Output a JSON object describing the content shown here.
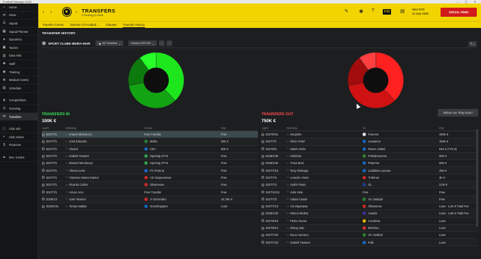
{
  "window": {
    "title": "Football Manager 2023",
    "controls": "– ▢ ✕"
  },
  "sidebar": {
    "items": [
      {
        "label": "Home",
        "icon": "home-icon",
        "glyph": "⌂"
      },
      {
        "label": "Inbox",
        "icon": "inbox-icon",
        "glyph": "✉"
      },
      {
        "label": "Squad",
        "icon": "squad-icon",
        "glyph": "☰"
      },
      {
        "label": "Squad Planner",
        "icon": "planner-icon",
        "glyph": "▦"
      },
      {
        "label": "Dynamics",
        "icon": "dynamics-icon",
        "glyph": "♥"
      },
      {
        "label": "Tactics",
        "icon": "tactics-icon",
        "glyph": "▣"
      },
      {
        "label": "Data Hub",
        "icon": "data-hub-icon",
        "glyph": "▥"
      },
      {
        "label": "Staff",
        "icon": "staff-icon",
        "glyph": "☻"
      },
      {
        "label": "Training",
        "icon": "training-icon",
        "glyph": "◉"
      },
      {
        "label": "Medical Centre",
        "icon": "medical-icon",
        "glyph": "✚"
      },
      {
        "label": "Schedule",
        "icon": "schedule-icon",
        "glyph": "▤"
      },
      {
        "label": "Competitions",
        "icon": "trophy-icon",
        "glyph": "♛"
      },
      {
        "label": "Scouting",
        "icon": "scouting-icon",
        "glyph": "◎"
      },
      {
        "label": "Transfers",
        "icon": "transfers-icon",
        "glyph": "⇄"
      },
      {
        "label": "Club Info",
        "icon": "club-info-icon",
        "glyph": "ⓘ"
      },
      {
        "label": "Club Vision",
        "icon": "club-vision-icon",
        "glyph": "◐"
      },
      {
        "label": "Finances",
        "icon": "finances-icon",
        "glyph": "$"
      },
      {
        "label": "Dev. Centre",
        "icon": "dev-centre-icon",
        "glyph": "▲"
      }
    ],
    "active_index": 13
  },
  "header": {
    "title": "TRANSFERS",
    "subtitle": "0 Pending (0) HAHI",
    "date_line1": "Wed 9:00",
    "date_line2": "13 Sep 2028",
    "social_feed": "SOCIAL FEED",
    "accent": "#f2d500"
  },
  "subnav": {
    "tabs": [
      "Transfer Centre",
      "Director of Football ⌄",
      "Clauses",
      "Transfer History"
    ],
    "active_index": 3
  },
  "page": {
    "section_title": "TRANSFER HISTORY",
    "club_name": "SPORT CLUBE BEIRA-MAR",
    "filter_label": "All Transfers",
    "season_label": "Season 2027/28",
    "where_button": "Where Are They Now?"
  },
  "transfers_in": {
    "title": "TRANSFERS IN",
    "total": "100K €",
    "color": "#35e05a",
    "headers": [
      "DATE",
      "PERSON",
      "FROM",
      "FEE"
    ],
    "rows": [
      {
        "date": "2027/7/1",
        "person": "Imanol Michelucci",
        "club": "Free Transfer",
        "fee": "Free",
        "badge": ""
      },
      {
        "date": "2027/7/1",
        "person": "José Eduardo",
        "club": "Mafra",
        "fee": "25K €",
        "badge": "#2e7d32"
      },
      {
        "date": "2027/7/1",
        "person": "Clodoil",
        "club": "CEA",
        "fee": "60K €",
        "badge": "#1565c0"
      },
      {
        "date": "2027/7/1",
        "person": "Gabriel Tavares",
        "club": "Sporting CP B",
        "fee": "Free",
        "badge": "#2e9e4f"
      },
      {
        "date": "2027/7/1",
        "person": "Manuel Mendonça",
        "club": "Sporting CP B",
        "fee": "Free",
        "badge": "#2e9e4f"
      },
      {
        "date": "2027/7/1",
        "person": "Afonso Leite",
        "club": "FC Porto B",
        "fee": "Free",
        "badge": "#1e63c6"
      },
      {
        "date": "2027/7/1",
        "person": "Vitoriano Manta Santos",
        "club": "AD Sanjoanense",
        "fee": "Free",
        "badge": "#c62828"
      },
      {
        "date": "2027/7/1",
        "person": "Ricardo Carlos",
        "club": "Oliveirense",
        "fee": "Free",
        "badge": "#c62828"
      },
      {
        "date": "2027/7/1",
        "person": "Arturo Arce",
        "club": "Free Transfer",
        "fee": "Free",
        "badge": ""
      },
      {
        "date": "2028/1/3",
        "person": "José Teixeira",
        "club": "1º Dezembro",
        "fee": "16,75K €",
        "badge": "#c62828"
      },
      {
        "date": "2028/1/31",
        "person": "Tomas Mabila",
        "club": "Grasshoppers",
        "fee": "Loan",
        "badge": "#1565c0"
      }
    ],
    "selected_index": 0
  },
  "transfers_out": {
    "title": "TRANSFERS OUT",
    "total": "750K €",
    "color": "#ff4d4d",
    "headers": [
      "DATE",
      "PERSON",
      "TO",
      "FEE"
    ],
    "rows": [
      {
        "date": "2027/8/31",
        "person": "Serginho",
        "club": "Farense",
        "fee": "400K €",
        "badge": "#dddddd"
      },
      {
        "date": "2027/7/1",
        "person": "Olivio Tomé",
        "club": "Lausanne",
        "fee": "150K €",
        "badge": "#1565c0"
      },
      {
        "date": "2027/9/4",
        "person": "Salefu Oche",
        "club": "Rivers United",
        "fee": "61K € (77K €)",
        "badge": "#1565c0"
      },
      {
        "date": "2028/1/30",
        "person": "Vieirinha",
        "club": "Pinhalnovense",
        "fee": "60K €",
        "badge": "#2e7d32"
      },
      {
        "date": "2028/1/30",
        "person": "Trova Boni",
        "club": "Praiense",
        "fee": "60K €",
        "badge": "#1565c0"
      },
      {
        "date": "2027/7/10",
        "person": "Tony Shimaga",
        "club": "Lusitânia Lourosa",
        "fee": "20K €",
        "badge": "#1565c0"
      },
      {
        "date": "2027/7/3",
        "person": "Leandro Vieira",
        "club": "Trofense",
        "fee": "3K €",
        "badge": "#c62828"
      },
      {
        "date": "2027/7/4",
        "person": "André Paulo",
        "club": "OL",
        "fee": "2,5K €",
        "badge": "#1e3f8f"
      },
      {
        "date": "2027/10/11",
        "person": "João Vela",
        "club": "Free",
        "fee": "Free",
        "badge": ""
      },
      {
        "date": "2027/7/3",
        "person": "Adulai Candé",
        "club": "Vit. Setubal",
        "fee": "Free",
        "badge": "#2e7d32"
      },
      {
        "date": "2027/7/13",
        "person": "Aoi Miyazawa",
        "club": "Olhanense",
        "fee": "Loan - 2,4K € Total Fee",
        "badge": "#c62828"
      },
      {
        "date": "2028/1/30",
        "person": "Nelson Molina",
        "club": "Anadia",
        "fee": "Loan - 1,5K € Total Fee",
        "badge": "#333399"
      },
      {
        "date": "2027/8/18",
        "person": "Pedro Sousa",
        "club": "Condeixa",
        "fee": "Loan",
        "badge": "#d8b400"
      },
      {
        "date": "2027/8/12",
        "person": "Zheng Jian",
        "club": "Meizhou",
        "fee": "Loan",
        "badge": "#cc3333"
      },
      {
        "date": "2027/7/22",
        "person": "Nuno Carneiro",
        "club": "Vit. Setúbal",
        "fee": "Loan",
        "badge": "#2e7d32"
      },
      {
        "date": "2027/7/23",
        "person": "Gabriel Tavares",
        "club": "Fafe",
        "fee": "Loan",
        "badge": "#1565c0"
      }
    ],
    "selected_index": -1
  },
  "donuts": {
    "in_colors": [
      "#1de61d",
      "#13a413",
      "#0d7a0d",
      "#28ff28"
    ],
    "out_colors": [
      "#ff2020",
      "#d01212",
      "#a30c0c",
      "#ff4040"
    ]
  }
}
